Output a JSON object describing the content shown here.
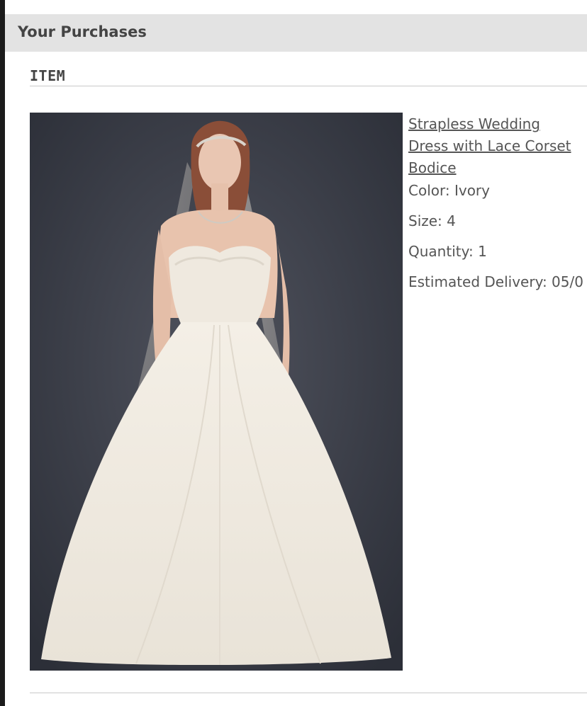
{
  "header": {
    "title": "Your Purchases"
  },
  "table": {
    "column_header": "ITEM"
  },
  "item": {
    "image_alt": "Strapless Wedding Dress with Lace Corset Bodice",
    "name_lines": [
      "Strapless Wedding",
      "Dress with Lace Corset",
      "Bodice"
    ],
    "color": "Color: Ivory",
    "size": "Size: 4",
    "quantity": "Quantity: 1",
    "estimated_delivery": "Estimated Delivery: 05/0"
  },
  "colors": {
    "header_bg": "#e3e3e3",
    "text": "#555555",
    "photo_backdrop": "#3a3d48",
    "dress": "#f2ede4"
  }
}
